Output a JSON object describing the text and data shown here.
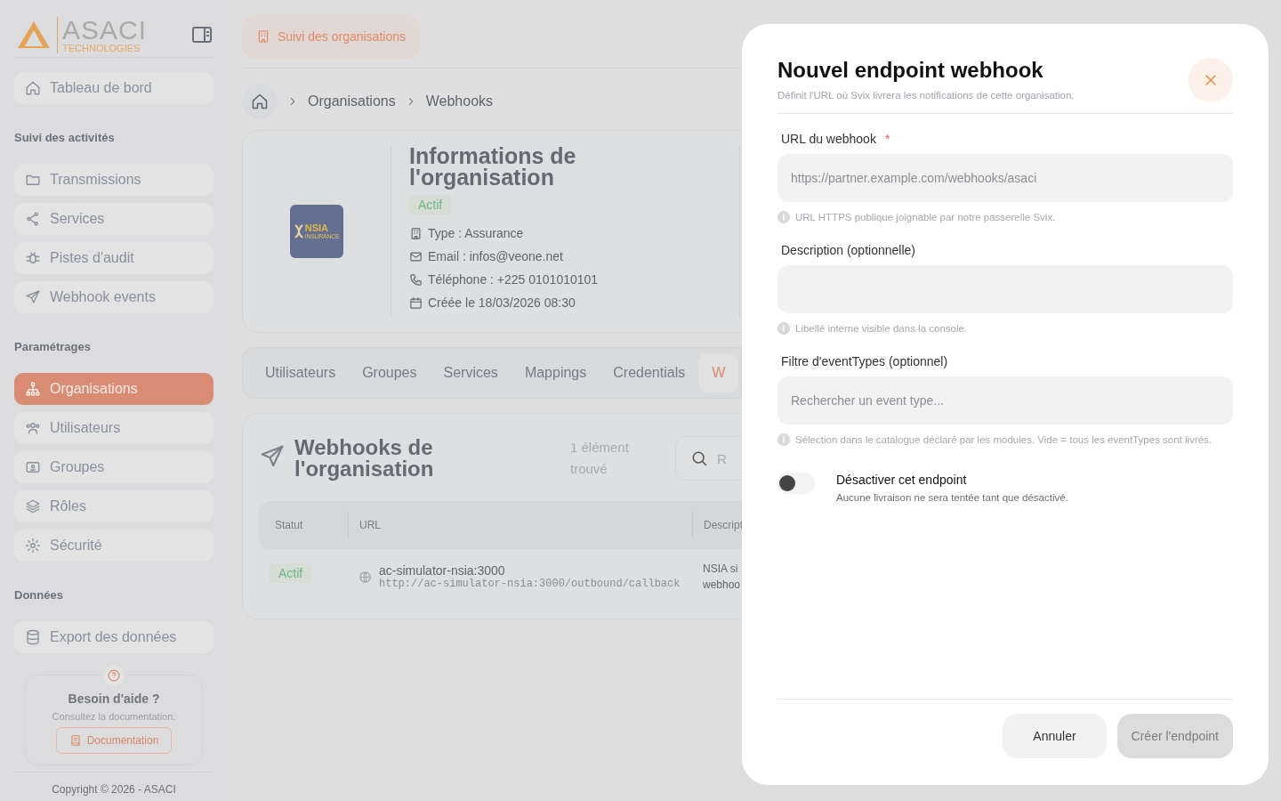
{
  "sidebar": {
    "logo": {
      "name": "ASACI",
      "tagline": "TECHNOLOGIES"
    },
    "top_item": {
      "label": "Tableau de bord",
      "selected": false
    },
    "sections": [
      {
        "title": "Suivi des activités",
        "items": [
          {
            "label": "Transmissions",
            "selected": false
          },
          {
            "label": "Services",
            "selected": false
          },
          {
            "label": "Pistes d'audit",
            "selected": false
          },
          {
            "label": "Webhook events",
            "selected": false
          }
        ]
      },
      {
        "title": "Paramétrages",
        "items": [
          {
            "label": "Organisations",
            "selected": true
          },
          {
            "label": "Utilisateurs",
            "selected": false
          },
          {
            "label": "Groupes",
            "selected": false
          },
          {
            "label": "Rôles",
            "selected": false
          },
          {
            "label": "Sécurité",
            "selected": false
          }
        ]
      },
      {
        "title": "Données",
        "items": [
          {
            "label": "Export des données",
            "selected": false
          }
        ]
      }
    ],
    "help": {
      "title": "Besoin d'aide ?",
      "text": "Consultez la documentation.",
      "button": "Documentation"
    },
    "copyright": "Copyright © 2026 - ASACI"
  },
  "header": {
    "chip": "Suivi des organisations"
  },
  "breadcrumb": [
    "Organisations",
    "Webhooks"
  ],
  "organisation": {
    "logo_text": "NSIA",
    "logo_subtext": "INSURANCE",
    "title": "Informations de l'organisation",
    "status": "Actif",
    "details": [
      "Type : Assurance",
      "Email : infos@veone.net",
      "Téléphone : +225 0101010101",
      "Créée le 18/03/2026 08:30"
    ]
  },
  "tabs": [
    {
      "label": "Utilisateurs",
      "selected": false
    },
    {
      "label": "Groupes",
      "selected": false
    },
    {
      "label": "Services",
      "selected": false
    },
    {
      "label": "Mappings",
      "selected": false
    },
    {
      "label": "Credentials",
      "selected": false
    },
    {
      "label": "W",
      "selected": true
    }
  ],
  "webhooks": {
    "title": "Webhooks de l'organisation",
    "count": "1 élément trouvé",
    "search_placeholder": "R",
    "table": {
      "columns": [
        "Statut",
        "URL",
        "Descript"
      ],
      "rows": [
        {
          "status": "Actif",
          "url_name": "ac-simulator-nsia:3000",
          "url": "http://ac-simulator-nsia:3000/outbound/callback",
          "description_lines": [
            "NSIA si",
            "webhoo"
          ]
        }
      ]
    }
  },
  "modal": {
    "title": "Nouvel endpoint webhook",
    "subtitle": "Définit l'URL où Svix livrera les notifications de cette organisation.",
    "fields": [
      {
        "label": "URL du webhook",
        "required": true,
        "required_mark": "*",
        "placeholder": "https://partner.example.com/webhooks/asaci",
        "hint": "URL HTTPS publique joignable par notre passerelle Svix."
      },
      {
        "label": "Description (optionnelle)",
        "hint": "Libellé interne visible dans la console."
      },
      {
        "label": "Filtre d'eventTypes (optionnel)",
        "placeholder": "Rechercher un event type...",
        "hint": "Sélection dans le catalogue déclaré par les modules. Vide = tous les eventTypes sont livrés."
      }
    ],
    "toggle": {
      "label": "Désactiver cet endpoint",
      "hint": "Aucune livraison ne sera tentée tant que désactivé.",
      "on": false
    },
    "buttons": [
      {
        "label": "Annuler",
        "kind": "secondary",
        "disabled": false
      },
      {
        "label": "Créer l'endpoint",
        "kind": "primary",
        "disabled": true
      }
    ]
  }
}
